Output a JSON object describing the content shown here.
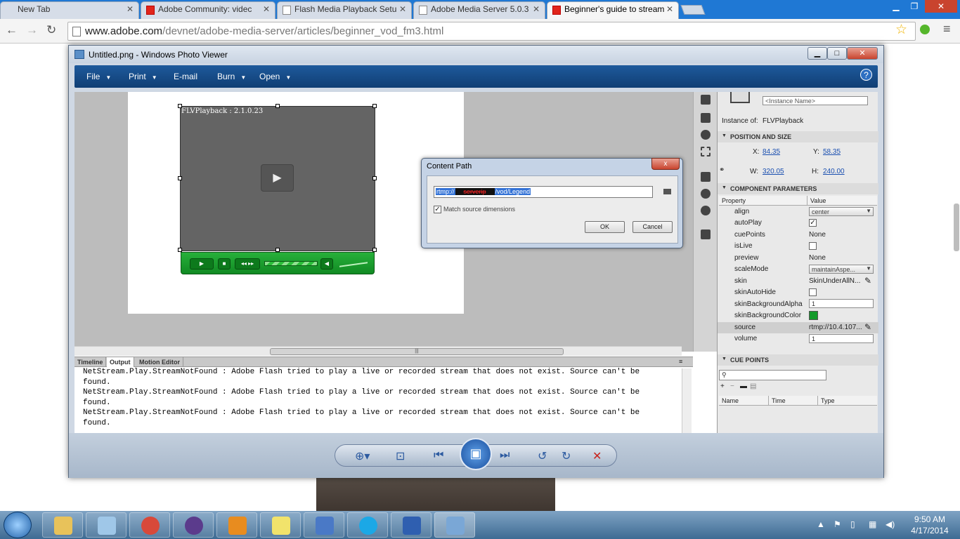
{
  "browser": {
    "tabs": [
      {
        "title": "New Tab",
        "active": false
      },
      {
        "title": "Adobe Community: videc",
        "active": false
      },
      {
        "title": "Flash Media Playback Setu",
        "active": false
      },
      {
        "title": "Adobe Media Server 5.0.3",
        "active": false
      },
      {
        "title": "Beginner's guide to stream",
        "active": true
      }
    ],
    "url_host": "www.adobe.com",
    "url_path": "/devnet/adobe-media-server/articles/beginner_vod_fm3.html"
  },
  "viewer": {
    "title": "Untitled.png - Windows Photo Viewer",
    "menu": [
      {
        "label": "File",
        "arrow": "▼"
      },
      {
        "label": "Print",
        "arrow": "▼"
      },
      {
        "label": "E-mail",
        "arrow": ""
      },
      {
        "label": "Burn",
        "arrow": "▼"
      },
      {
        "label": "Open",
        "arrow": "▼"
      }
    ],
    "help_symbol": "?"
  },
  "flash": {
    "component_label": "FLVPlayback : 2.1.0.23",
    "properties": {
      "instance_name_placeholder": "<Instance Name>",
      "instance_of_label": "Instance of:",
      "instance_of_value": "FLVPlayback",
      "position_section": "POSITION AND SIZE",
      "x_label": "X:",
      "x_value": "84.35",
      "y_label": "Y:",
      "y_value": "58.35",
      "w_label": "W:",
      "w_value": "320.05",
      "h_label": "H:",
      "h_value": "240.00",
      "component_section": "COMPONENT PARAMETERS",
      "col_property": "Property",
      "col_value": "Value",
      "params": [
        {
          "name": "align",
          "type": "dropdown",
          "value": "center"
        },
        {
          "name": "autoPlay",
          "type": "checkbox",
          "checked": true
        },
        {
          "name": "cuePoints",
          "type": "text",
          "value": "None"
        },
        {
          "name": "isLive",
          "type": "checkbox",
          "checked": false
        },
        {
          "name": "preview",
          "type": "text",
          "value": "None"
        },
        {
          "name": "scaleMode",
          "type": "dropdown",
          "value": "maintainAspe..."
        },
        {
          "name": "skin",
          "type": "edit",
          "value": "SkinUnderAllN..."
        },
        {
          "name": "skinAutoHide",
          "type": "checkbox",
          "checked": false
        },
        {
          "name": "skinBackgroundAlpha",
          "type": "input",
          "value": "1"
        },
        {
          "name": "skinBackgroundColor",
          "type": "color",
          "color": "#139a2a"
        },
        {
          "name": "source",
          "type": "edit",
          "value": "rtmp://10.4.107..."
        },
        {
          "name": "volume",
          "type": "input",
          "value": "1"
        }
      ],
      "cue_section": "CUE POINTS",
      "cue_cols": [
        "Name",
        "Time",
        "Type"
      ]
    },
    "output": {
      "tabs": [
        "Timeline",
        "Output",
        "Motion Editor"
      ],
      "selected_tab": "Output",
      "lines": [
        "NetStream.Play.StreamNotFound : Adobe Flash tried to play a live or recorded stream that does not exist. Source can't be",
        "found.",
        "NetStream.Play.StreamNotFound : Adobe Flash tried to play a live or recorded stream that does not exist. Source can't be",
        "found.",
        "NetStream.Play.StreamNotFound : Adobe Flash tried to play a live or recorded stream that does not exist. Source can't be",
        "found."
      ]
    }
  },
  "dialog": {
    "title": "Content Path",
    "close_symbol": "x",
    "path_prefix": "rtmp://",
    "path_redacted": "serverip",
    "path_suffix": "/vod/Legend",
    "match_label": "Match source dimensions",
    "match_checked": true,
    "ok_label": "OK",
    "cancel_label": "Cancel"
  },
  "taskbar": {
    "time": "9:50 AM",
    "date": "4/17/2014",
    "apps": [
      {
        "name": "explorer",
        "color": "#e8c25a"
      },
      {
        "name": "notes",
        "color": "#9fc7e8"
      },
      {
        "name": "chrome",
        "color": "#d8493a"
      },
      {
        "name": "eclipse",
        "color": "#5b3b8c"
      },
      {
        "name": "outlook",
        "color": "#e88c1f"
      },
      {
        "name": "sticky-notes",
        "color": "#f1e36b"
      },
      {
        "name": "network",
        "color": "#4a79c6"
      },
      {
        "name": "skype",
        "color": "#1ba8e6"
      },
      {
        "name": "word",
        "color": "#2f5fb0"
      },
      {
        "name": "photo-viewer",
        "color": "#7aa7d6"
      }
    ]
  }
}
